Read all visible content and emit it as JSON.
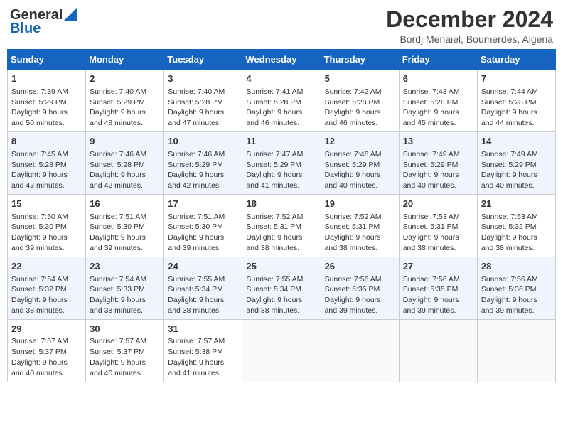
{
  "logo": {
    "line1": "General",
    "line2": "Blue"
  },
  "title": "December 2024",
  "location": "Bordj Menaiel, Boumerdes, Algeria",
  "weekdays": [
    "Sunday",
    "Monday",
    "Tuesday",
    "Wednesday",
    "Thursday",
    "Friday",
    "Saturday"
  ],
  "weeks": [
    [
      {
        "day": "1",
        "sunrise": "7:39 AM",
        "sunset": "5:29 PM",
        "daylight": "9 hours and 50 minutes."
      },
      {
        "day": "2",
        "sunrise": "7:40 AM",
        "sunset": "5:29 PM",
        "daylight": "9 hours and 48 minutes."
      },
      {
        "day": "3",
        "sunrise": "7:40 AM",
        "sunset": "5:28 PM",
        "daylight": "9 hours and 47 minutes."
      },
      {
        "day": "4",
        "sunrise": "7:41 AM",
        "sunset": "5:28 PM",
        "daylight": "9 hours and 46 minutes."
      },
      {
        "day": "5",
        "sunrise": "7:42 AM",
        "sunset": "5:28 PM",
        "daylight": "9 hours and 46 minutes."
      },
      {
        "day": "6",
        "sunrise": "7:43 AM",
        "sunset": "5:28 PM",
        "daylight": "9 hours and 45 minutes."
      },
      {
        "day": "7",
        "sunrise": "7:44 AM",
        "sunset": "5:28 PM",
        "daylight": "9 hours and 44 minutes."
      }
    ],
    [
      {
        "day": "8",
        "sunrise": "7:45 AM",
        "sunset": "5:28 PM",
        "daylight": "9 hours and 43 minutes."
      },
      {
        "day": "9",
        "sunrise": "7:46 AM",
        "sunset": "5:28 PM",
        "daylight": "9 hours and 42 minutes."
      },
      {
        "day": "10",
        "sunrise": "7:46 AM",
        "sunset": "5:29 PM",
        "daylight": "9 hours and 42 minutes."
      },
      {
        "day": "11",
        "sunrise": "7:47 AM",
        "sunset": "5:29 PM",
        "daylight": "9 hours and 41 minutes."
      },
      {
        "day": "12",
        "sunrise": "7:48 AM",
        "sunset": "5:29 PM",
        "daylight": "9 hours and 40 minutes."
      },
      {
        "day": "13",
        "sunrise": "7:49 AM",
        "sunset": "5:29 PM",
        "daylight": "9 hours and 40 minutes."
      },
      {
        "day": "14",
        "sunrise": "7:49 AM",
        "sunset": "5:29 PM",
        "daylight": "9 hours and 40 minutes."
      }
    ],
    [
      {
        "day": "15",
        "sunrise": "7:50 AM",
        "sunset": "5:30 PM",
        "daylight": "9 hours and 39 minutes."
      },
      {
        "day": "16",
        "sunrise": "7:51 AM",
        "sunset": "5:30 PM",
        "daylight": "9 hours and 39 minutes."
      },
      {
        "day": "17",
        "sunrise": "7:51 AM",
        "sunset": "5:30 PM",
        "daylight": "9 hours and 39 minutes."
      },
      {
        "day": "18",
        "sunrise": "7:52 AM",
        "sunset": "5:31 PM",
        "daylight": "9 hours and 38 minutes."
      },
      {
        "day": "19",
        "sunrise": "7:52 AM",
        "sunset": "5:31 PM",
        "daylight": "9 hours and 38 minutes."
      },
      {
        "day": "20",
        "sunrise": "7:53 AM",
        "sunset": "5:31 PM",
        "daylight": "9 hours and 38 minutes."
      },
      {
        "day": "21",
        "sunrise": "7:53 AM",
        "sunset": "5:32 PM",
        "daylight": "9 hours and 38 minutes."
      }
    ],
    [
      {
        "day": "22",
        "sunrise": "7:54 AM",
        "sunset": "5:32 PM",
        "daylight": "9 hours and 38 minutes."
      },
      {
        "day": "23",
        "sunrise": "7:54 AM",
        "sunset": "5:33 PM",
        "daylight": "9 hours and 38 minutes."
      },
      {
        "day": "24",
        "sunrise": "7:55 AM",
        "sunset": "5:34 PM",
        "daylight": "9 hours and 38 minutes."
      },
      {
        "day": "25",
        "sunrise": "7:55 AM",
        "sunset": "5:34 PM",
        "daylight": "9 hours and 38 minutes."
      },
      {
        "day": "26",
        "sunrise": "7:56 AM",
        "sunset": "5:35 PM",
        "daylight": "9 hours and 39 minutes."
      },
      {
        "day": "27",
        "sunrise": "7:56 AM",
        "sunset": "5:35 PM",
        "daylight": "9 hours and 39 minutes."
      },
      {
        "day": "28",
        "sunrise": "7:56 AM",
        "sunset": "5:36 PM",
        "daylight": "9 hours and 39 minutes."
      }
    ],
    [
      {
        "day": "29",
        "sunrise": "7:57 AM",
        "sunset": "5:37 PM",
        "daylight": "9 hours and 40 minutes."
      },
      {
        "day": "30",
        "sunrise": "7:57 AM",
        "sunset": "5:37 PM",
        "daylight": "9 hours and 40 minutes."
      },
      {
        "day": "31",
        "sunrise": "7:57 AM",
        "sunset": "5:38 PM",
        "daylight": "9 hours and 41 minutes."
      },
      null,
      null,
      null,
      null
    ]
  ]
}
